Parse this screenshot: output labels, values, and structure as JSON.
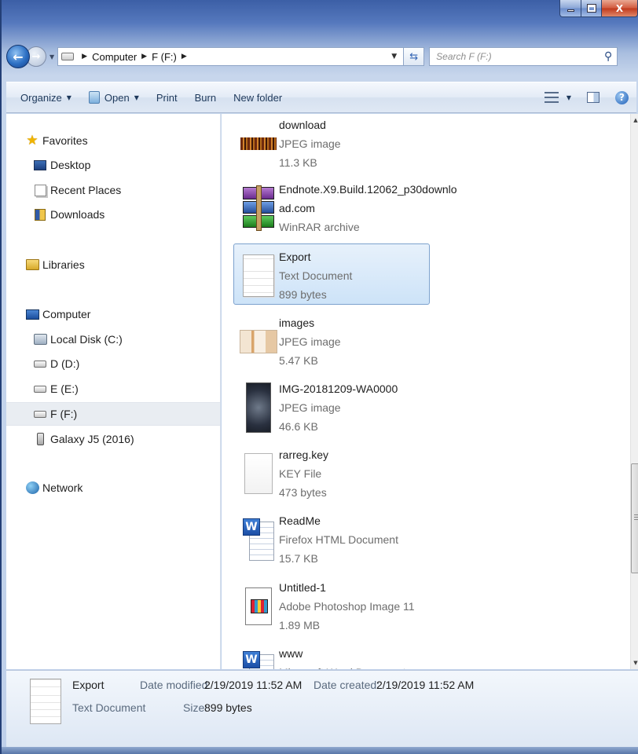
{
  "window": {
    "controls": {
      "minimize": "",
      "maximize": "",
      "close": "X"
    }
  },
  "navbar": {
    "breadcrumbs": [
      "Computer",
      "F (F:)"
    ],
    "search_placeholder": "Search F (F:)"
  },
  "toolbar": {
    "organize": "Organize",
    "open": "Open",
    "print": "Print",
    "burn": "Burn",
    "new_folder": "New folder"
  },
  "sidebar": {
    "favorites": {
      "label": "Favorites",
      "items": [
        "Desktop",
        "Recent Places",
        "Downloads"
      ]
    },
    "libraries": {
      "label": "Libraries"
    },
    "computer": {
      "label": "Computer",
      "items": [
        "Local Disk (C:)",
        "D (D:)",
        "E (E:)",
        "F (F:)",
        "Galaxy J5 (2016)"
      ],
      "selected": "F (F:)"
    },
    "network": {
      "label": "Network"
    }
  },
  "files": [
    {
      "name": "download",
      "type": "JPEG image",
      "size": "11.3 KB",
      "icon": "jpeg-thumbnail"
    },
    {
      "name": "Endnote.X9.Build.12062_p30downlo",
      "name2": "ad.com",
      "type": "WinRAR archive",
      "size": "",
      "icon": "winrar-icon"
    },
    {
      "name": "Export",
      "type": "Text Document",
      "size": "899 bytes",
      "icon": "text-document-icon",
      "selected": true
    },
    {
      "name": "images",
      "type": "JPEG image",
      "size": "5.47 KB",
      "icon": "jpeg-thumbnail"
    },
    {
      "name": "IMG-20181209-WA0000",
      "type": "JPEG image",
      "size": "46.6 KB",
      "icon": "jpeg-thumbnail"
    },
    {
      "name": "rarreg.key",
      "type": "KEY File",
      "size": "473 bytes",
      "icon": "blank-file-icon"
    },
    {
      "name": "ReadMe",
      "type": "Firefox HTML Document",
      "size": "15.7 KB",
      "icon": "word-document-icon"
    },
    {
      "name": "Untitled-1",
      "type": "Adobe Photoshop Image 11",
      "size": "1.89 MB",
      "icon": "photoshop-file-icon"
    },
    {
      "name": "www",
      "type": "Microsoft Word Document",
      "size": "",
      "icon": "word-document-icon"
    }
  ],
  "details": {
    "name": "Export",
    "type": "Text Document",
    "modified_label": "Date modified:",
    "modified_value": "2/19/2019 11:52 AM",
    "created_label": "Date created:",
    "created_value": "2/19/2019 11:52 AM",
    "size_label": "Size:",
    "size_value": "899 bytes"
  }
}
